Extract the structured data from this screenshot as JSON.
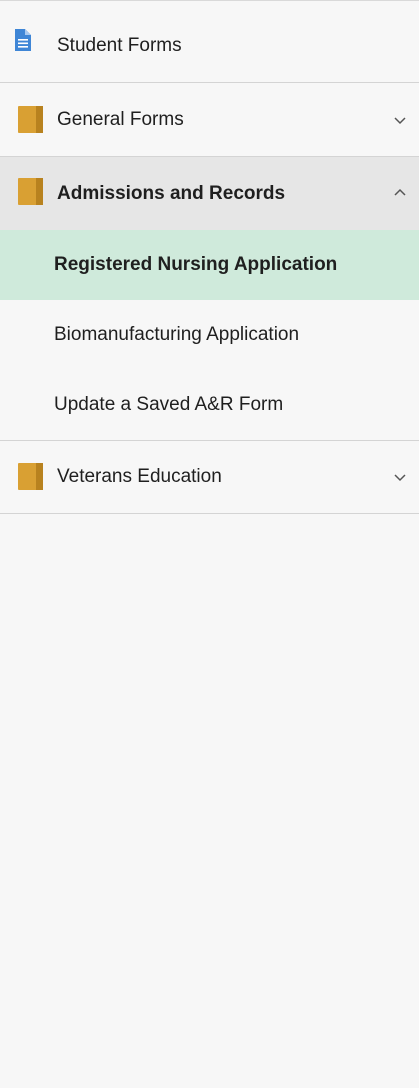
{
  "nav": {
    "student_forms": {
      "label": "Student Forms",
      "icon": "document-icon"
    },
    "general_forms": {
      "label": "General Forms",
      "icon": "folder-icon",
      "expanded": false
    },
    "admissions": {
      "label": "Admissions and Records",
      "icon": "folder-icon",
      "expanded": true,
      "items": [
        {
          "label": "Registered Nursing Application",
          "selected": true
        },
        {
          "label": "Biomanufacturing Application",
          "selected": false
        },
        {
          "label": "Update a Saved A&R Form",
          "selected": false
        }
      ]
    },
    "veterans": {
      "label": "Veterans Education",
      "icon": "folder-icon",
      "expanded": false
    }
  },
  "colors": {
    "background": "#f7f7f7",
    "expanded_header": "#e6e6e6",
    "selected_item": "#cfeadb",
    "folder": "#d9a033",
    "document": "#3f86d6"
  }
}
